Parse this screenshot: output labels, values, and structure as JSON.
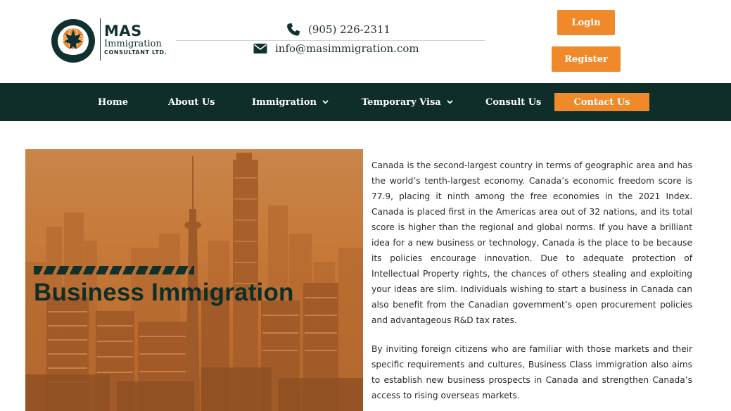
{
  "brand": {
    "arc_text": "MIGRATE & SETTLE",
    "name": "MAS",
    "line1": "Immigration",
    "line2": "CONSULTANT LTD."
  },
  "contact": {
    "phone": "(905) 226-2311",
    "email": "info@masimmigration.com"
  },
  "auth": {
    "login_label": "Login",
    "register_label": "Register"
  },
  "nav": {
    "items": [
      {
        "label": "Home"
      },
      {
        "label": "About Us"
      },
      {
        "label": "Immigration"
      },
      {
        "label": "Temporary Visa"
      },
      {
        "label": "Consult Us"
      }
    ],
    "cta_label": "Contact Us"
  },
  "hero": {
    "title": "Business Immigration"
  },
  "article": {
    "paragraphs": [
      "Canada is the second-largest country in terms of geographic area and has the world’s tenth-largest economy. Canada’s economic freedom score is 77.9, placing it ninth among the free economies in the 2021 Index. Canada is placed first in the Americas area out of 32 nations, and its total score is higher than the regional and global norms. If you have a brilliant idea for a new business or technology, Canada is the place to be because its policies encourage innovation. Due to adequate protection of Intellectual Property rights, the chances of others stealing and exploiting your ideas are slim. Individuals wishing to start a business in Canada can also benefit from the Canadian government’s open procurement policies and advantageous R&D tax rates.",
      "By inviting foreign citizens who are familiar with those markets and their specific requirements and cultures, Business Class immigration also aims to establish new business prospects in Canada and strengthen Canada’s access to rising overseas markets."
    ]
  },
  "colors": {
    "accent": "#f0892a",
    "nav_bg": "#0f2d29",
    "brand_dark": "#113130"
  },
  "icons": {
    "phone": "phone-icon",
    "email": "envelope-icon",
    "dropdown": "chevron-down-icon"
  }
}
